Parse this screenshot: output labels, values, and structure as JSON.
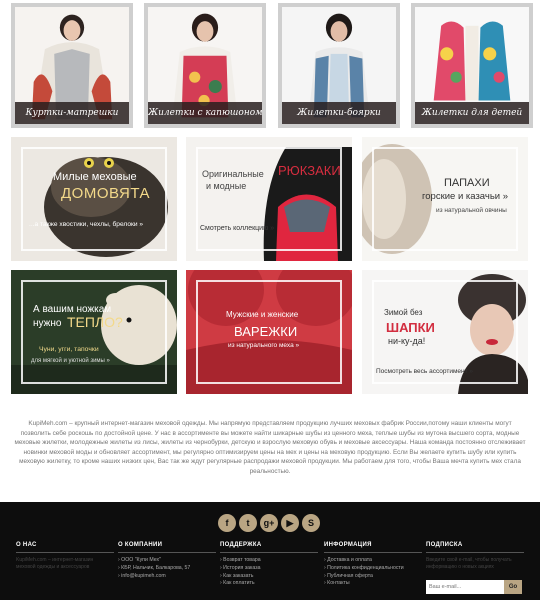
{
  "categories": [
    {
      "label": "Куртки-матрешки"
    },
    {
      "label": "Жилетки с капюшоном"
    },
    {
      "label": "Жилетки-боярки"
    },
    {
      "label": "Жилетки для детей"
    }
  ],
  "banners": {
    "domovyata": {
      "line1": "Милые меховые",
      "line2": "ДОМОВЯТА",
      "line3": "...а также хвостики, чехлы, брелоки »"
    },
    "backpacks": {
      "line1": "Оригинальные",
      "line2": "РЮКЗАКИ",
      "line3": "и модные",
      "line4": "Смотреть коллекцию »"
    },
    "papakhi": {
      "line1": "ПАПАХИ",
      "line2": "горские и казачьи »",
      "line3": "из натуральной овчины"
    },
    "slippers": {
      "line1": "А вашим ножкам",
      "line2": "нужно",
      "line3": "ТЕПЛО?",
      "line4": "Чуни, угги, тапочки",
      "line5": "для мягкой и уютной зимы »"
    },
    "mittens": {
      "line1": "Мужские и женские",
      "line2": "ВАРЕЖКИ",
      "line3": "из натурального меха »"
    },
    "hats": {
      "line1": "Зимой без",
      "line2": "ШАПКИ",
      "line3": "ни-ку-да!",
      "line4": "Посмотреть весь ассортимент »"
    }
  },
  "about_text": "KupiMeh.com – крупный интернет-магазин меховой одежды. Мы напрямую представляем продукцию лучших меховых фабрик России,потому наши клиенты могут позволить себе роскошь по достойной цене. У нас в ассортименте вы можете найти шикарные шубы из ценного меха, теплые шубы из мутона высшего сорта, модные меховые жилетки, молодежные жилеты из лисы, жилеты из чернобурки, детскую и взрослую меховую обувь и меховые аксессуары. Наша команда постоянно отслеживает новинки меховой моды и обновляет ассортимент, мы регулярно оптимизируем цены на мех и цены на меховую продукцию. Если Вы желаете купить шубу или купить меховую жилетку, то кроме наших низких цен, Вас так же ждут регулярные распродажи меховой продукции. Мы работаем для того, чтобы Ваша мечта купить мех стала реальностью.",
  "socials": [
    {
      "icon": "facebook-icon",
      "glyph": "f"
    },
    {
      "icon": "twitter-icon",
      "glyph": "t"
    },
    {
      "icon": "google-plus-icon",
      "glyph": "g+"
    },
    {
      "icon": "youtube-icon",
      "glyph": "▶"
    },
    {
      "icon": "skype-icon",
      "glyph": "S"
    }
  ],
  "footer": {
    "about": {
      "title": "О НАС",
      "text": "KupiMeh.com – интернет-магазин меховой одежды и аксессуаров"
    },
    "company": {
      "title": "О КОМПАНИИ",
      "lines": [
        "ООО \"Купи Мех\"",
        "КБР, Нальчик, Балкарова, 57",
        "info@kupimeh.com"
      ]
    },
    "support": {
      "title": "ПОДДЕРЖКА",
      "links": [
        "Возврат товара",
        "История заказа",
        "Как заказать",
        "Как оплатить"
      ]
    },
    "info": {
      "title": "ИНФОРМАЦИЯ",
      "links": [
        "Доставка и оплата",
        "Политика конфиденциальности",
        "Публичная оферта",
        "Контакты"
      ]
    },
    "subscribe": {
      "title": "ПОДПИСКА",
      "text": "Введите свой e-mail, чтобы получать информацию о новых акциях",
      "placeholder": "Ваш e-mail...",
      "button": "Go"
    }
  }
}
